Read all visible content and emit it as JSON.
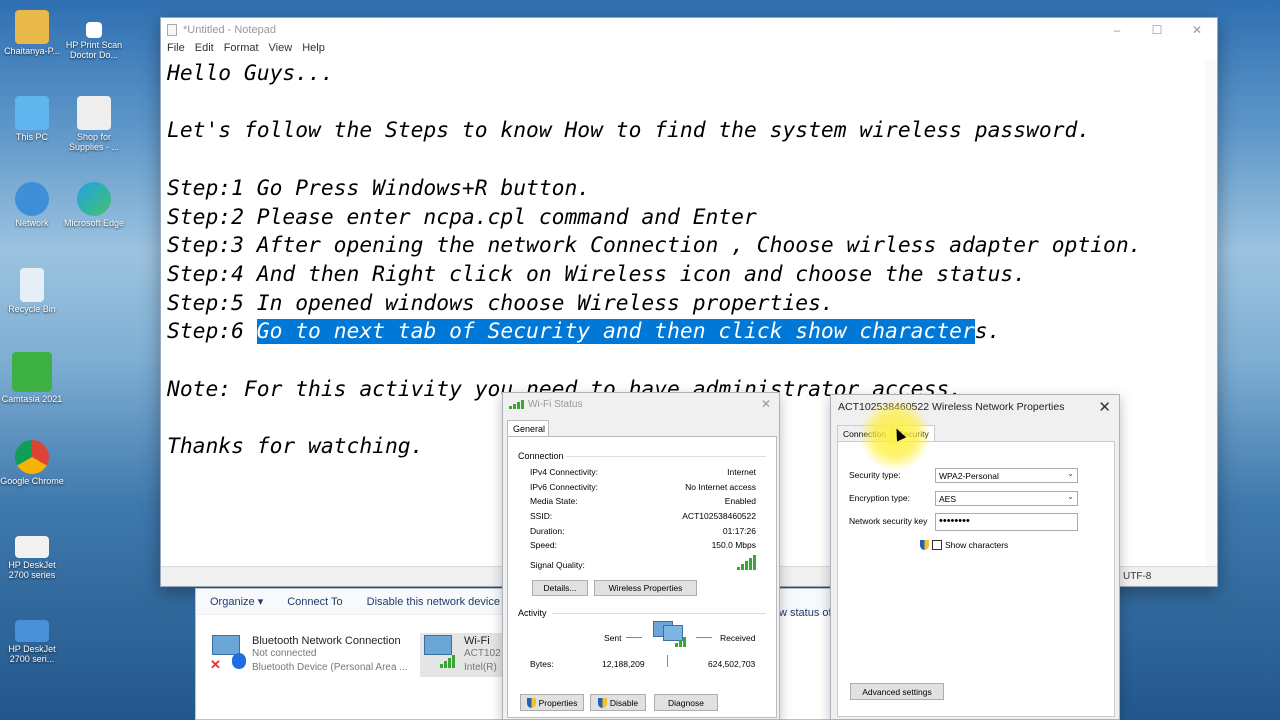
{
  "desktop": {
    "icons": [
      {
        "label": "Chaitanya-P..."
      },
      {
        "label": "HP Print Scan Doctor Do..."
      },
      {
        "label": "This PC"
      },
      {
        "label": "Shop for Supplies - ..."
      },
      {
        "label": "Network"
      },
      {
        "label": "Microsoft Edge"
      },
      {
        "label": "Recycle Bin"
      },
      {
        "label": "Camtasia 2021"
      },
      {
        "label": "Google Chrome"
      },
      {
        "label": "HP DeskJet 2700 series"
      },
      {
        "label": "HP DeskJet 2700 seri..."
      }
    ]
  },
  "notepad": {
    "title": "*Untitled - Notepad",
    "menu": [
      "File",
      "Edit",
      "Format",
      "View",
      "Help"
    ],
    "lines": {
      "l1": "Hello Guys...",
      "l2": "Let's follow the Steps to know How to find the system wireless password.",
      "l3": "Step:1 Go Press Windows+R button.",
      "l4": "Step:2 Please enter ncpa.cpl command and Enter",
      "l5": "Step:3 After opening the network Connection , Choose wirless adapter option.",
      "l6": "Step:4 And then Right click on Wireless icon and choose the status.",
      "l7": "Step:5 In opened windows choose Wireless properties.",
      "l8_prefix": "Step:6 ",
      "l8_selected": "Go to next tab of Security and then click show character",
      "l8_suffix": "s.",
      "l9": "Note: For this activity you need to have administrator access.",
      "l10": "Thanks for watching."
    },
    "status_encoding": "UTF-8"
  },
  "network_connections": {
    "toolbar": [
      "Organize ▾",
      "Connect To",
      "Disable this network device"
    ],
    "side_text": "w status of",
    "items": [
      {
        "name": "Bluetooth Network Connection",
        "status": "Not connected",
        "device": "Bluetooth Device (Personal Area ..."
      },
      {
        "name": "Wi-Fi",
        "status": "ACT102",
        "device": "Intel(R)"
      }
    ]
  },
  "wifi_status": {
    "title": "Wi-Fi Status",
    "tab": "General",
    "connection_label": "Connection",
    "rows": [
      {
        "k": "IPv4 Connectivity:",
        "v": "Internet"
      },
      {
        "k": "IPv6 Connectivity:",
        "v": "No Internet access"
      },
      {
        "k": "Media State:",
        "v": "Enabled"
      },
      {
        "k": "SSID:",
        "v": "ACT102538460522"
      },
      {
        "k": "Duration:",
        "v": "01:17:26"
      },
      {
        "k": "Speed:",
        "v": "150.0 Mbps"
      }
    ],
    "signal_label": "Signal Quality:",
    "details_btn": "Details...",
    "wireless_props_btn": "Wireless Properties",
    "activity_label": "Activity",
    "sent_label": "Sent",
    "received_label": "Received",
    "bytes_label": "Bytes:",
    "bytes_sent": "12,188,209",
    "bytes_received": "624,502,703",
    "properties_btn": "Properties",
    "disable_btn": "Disable",
    "diagnose_btn": "Diagnose"
  },
  "wireless_props": {
    "title": "ACT102538460522 Wireless Network Properties",
    "tabs": [
      "Connection",
      "Security"
    ],
    "security_type_label": "Security type:",
    "security_type": "WPA2-Personal",
    "encryption_type_label": "Encryption type:",
    "encryption_type": "AES",
    "key_label": "Network security key",
    "key_value": "••••••••",
    "show_chars": "Show characters",
    "advanced_btn": "Advanced settings"
  },
  "colors": {
    "selection": "#0078d7",
    "highlight": "#fff03c"
  }
}
